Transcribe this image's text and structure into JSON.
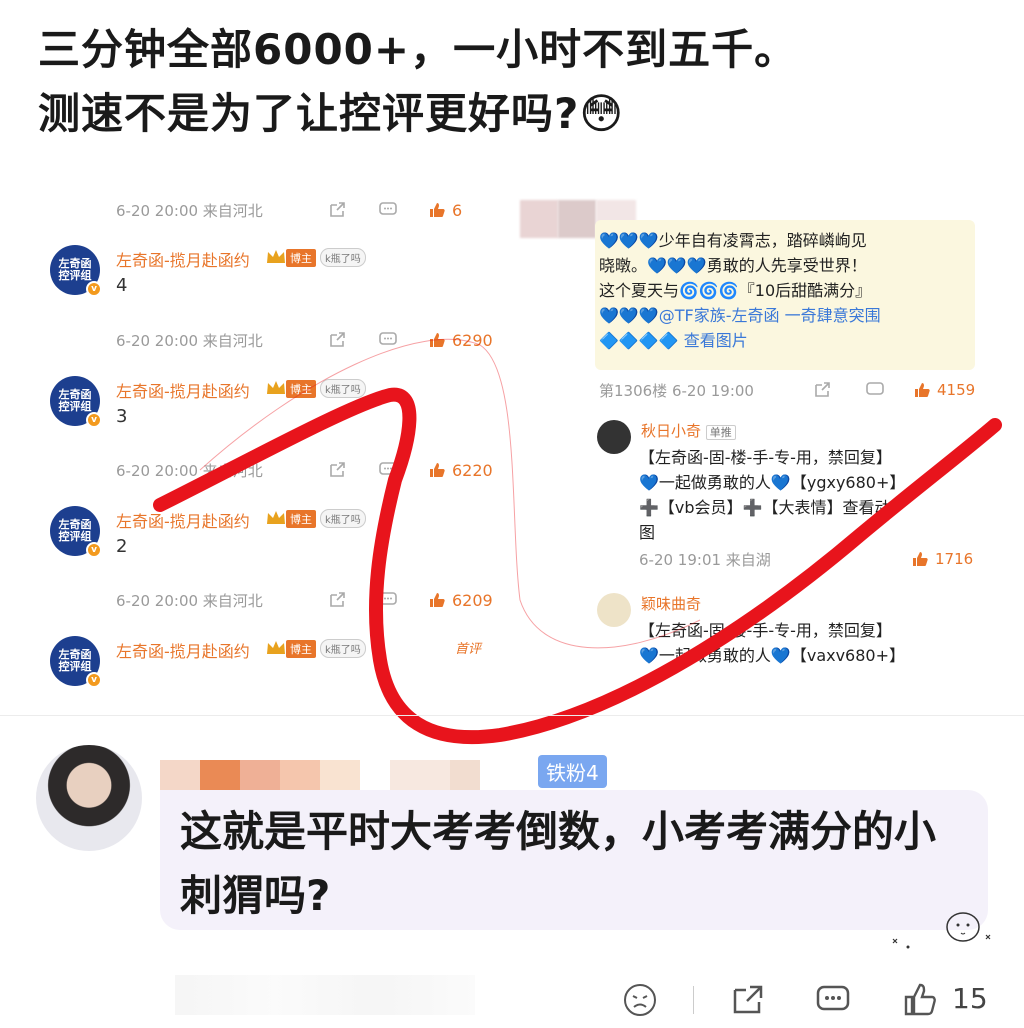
{
  "post": {
    "line1": "三分钟全部6000+，一小时不到五千。",
    "line2": "测速不是为了让控评更好吗?😳"
  },
  "embedded_left": {
    "meta_rows": [
      {
        "time": "6-20 20:00 来自河北",
        "likes": "6"
      },
      {
        "time": "6-20 20:00 来自河北",
        "likes": "6290"
      },
      {
        "time": "6-20 20:00 来自河北",
        "likes": "6220"
      },
      {
        "time": "6-20 20:00 来自河北",
        "likes": "6209"
      }
    ],
    "comments": [
      {
        "avatar_text": "左奇函控评组",
        "user": "左奇函-揽月赴函约",
        "host_badge": "博主",
        "k_badge": "k瓶了吗",
        "text": "4"
      },
      {
        "avatar_text": "左奇函控评组",
        "user": "左奇函-揽月赴函约",
        "host_badge": "博主",
        "k_badge": "k瓶了吗",
        "text": "3"
      },
      {
        "avatar_text": "左奇函控评组",
        "user": "左奇函-揽月赴函约",
        "host_badge": "博主",
        "k_badge": "k瓶了吗",
        "text": "2"
      },
      {
        "avatar_text": "左奇函控评组",
        "user": "左奇函-揽月赴函约",
        "host_badge": "博主",
        "k_badge": "k瓶了吗",
        "text": "",
        "tag": "首评"
      }
    ]
  },
  "embedded_right": {
    "main_text": {
      "l1": "💙💙💙少年自有凌霄志，踏碎嶙峋见",
      "l2": "晓暾。💙💙💙勇敢的人先享受世界！",
      "l3": "这个夏天与🌀🌀🌀『10后甜酷满分』",
      "l4": "💙💙💙@TF家族-左奇函 一奇肆意突围",
      "l5": "🔷🔷🔷🔷 查看图片"
    },
    "main_meta": {
      "floor": "第1306楼 6-20 19:00",
      "likes": "4159"
    },
    "reply1": {
      "user": "秋日小奇",
      "badge": "单推",
      "l1": "【左奇函-固-楼-手-专-用，禁回复】",
      "l2": "💙一起做勇敢的人💙【ygxy680+】",
      "l3": "➕【vb会员】➕【大表情】查看动",
      "l4": "图",
      "time": "6-20 19:01 来自湖",
      "likes": "1716"
    },
    "reply2": {
      "user": "颖味曲奇",
      "l1": "【左奇函-固-楼-手-专-用，禁回复】",
      "l2": "💙一起做勇敢的人💙【vaxv680+】"
    }
  },
  "reply": {
    "fan_badge": "铁粉4",
    "text": "这就是平时大考考倒数，小考考满分的小刺猬吗?"
  },
  "bottom": {
    "like_count": "15",
    "icons": [
      "dislike-face-icon",
      "share-icon",
      "comment-icon",
      "thumbs-up-icon"
    ]
  },
  "colors": {
    "accent_orange": "#e8752a",
    "scribble_red": "#e8141c",
    "fan_badge_blue": "#7aa7f0",
    "bubble_bg": "#f4f1fa"
  }
}
